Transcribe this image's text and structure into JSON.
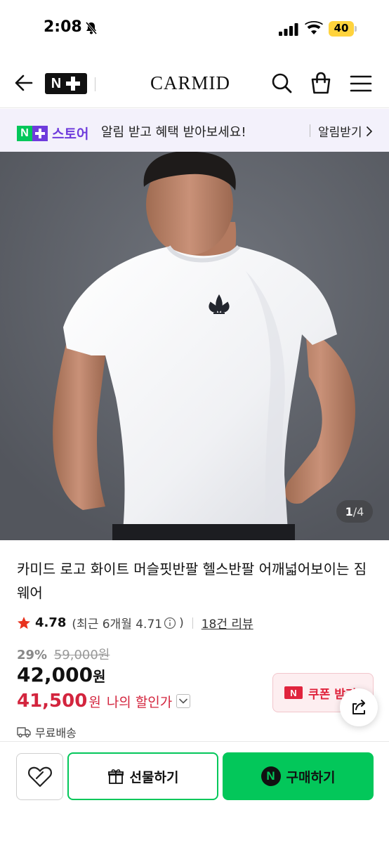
{
  "status_bar": {
    "time": "2:08",
    "battery": "40"
  },
  "header": {
    "brand": "CARMID",
    "logo_text": "N"
  },
  "notice": {
    "badge_n": "N",
    "store_label": "스토어",
    "text": "알림 받고 혜택 받아보세요!",
    "link_label": "알림받기"
  },
  "gallery": {
    "current": "1",
    "total": "4",
    "separator": "/"
  },
  "product": {
    "title": "카미드 로고 화이트 머슬핏반팔 헬스반팔 어깨넓어보이는 짐웨어",
    "rating": {
      "score": "4.78",
      "recent_label": "(최근 6개월 4.71",
      "recent_close": ")",
      "reviews": "18건 리뷰"
    },
    "price": {
      "discount": "29%",
      "original": "59,000원",
      "sale_amount": "42,000",
      "sale_unit": "원",
      "my_amount": "41,500",
      "my_unit": "원",
      "my_label": "나의 할인가"
    },
    "coupon": {
      "icon_text": "N",
      "label": "쿠폰 받기"
    },
    "shipping": "무료배송"
  },
  "bottom_bar": {
    "gift_label": "선물하기",
    "buy_label": "구매하기",
    "buy_icon_text": "N"
  },
  "colors": {
    "naver_green": "#03c75a",
    "plus_purple": "#6e3bdc",
    "price_red": "#d3253e",
    "coupon_red": "#e0243d",
    "battery_yellow": "#ffd33d"
  }
}
